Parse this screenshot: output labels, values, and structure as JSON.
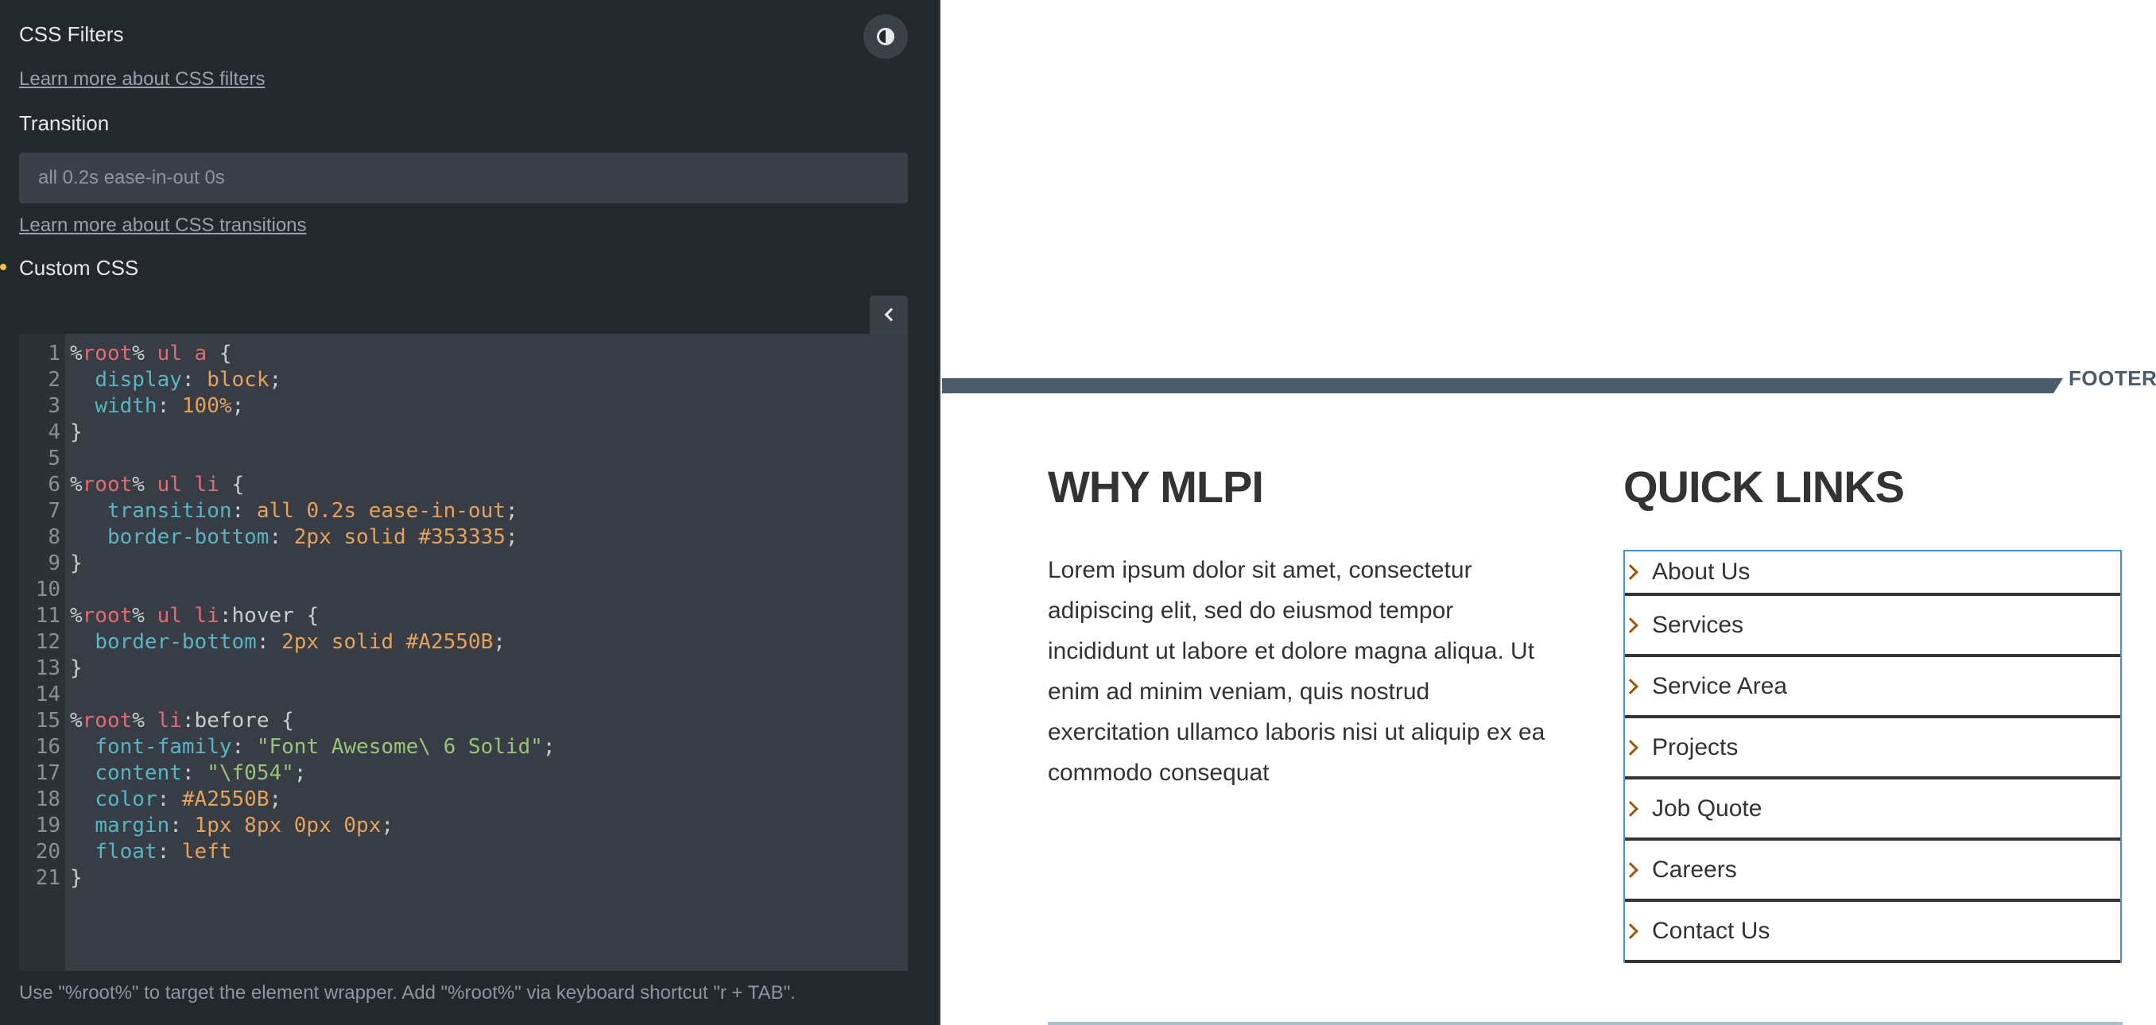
{
  "editor": {
    "title": "CSS Filters",
    "filters_link": "Learn more about CSS filters",
    "transition_label": "Transition",
    "transition_placeholder": "all 0.2s ease-in-out 0s",
    "transitions_link": "Learn more about CSS transitions",
    "custom_css_label": "Custom CSS",
    "contrast_icon": "contrast-icon",
    "collapse_icon": "chevron-left-icon",
    "help_text": "Use \"%root%\" to target the element wrapper. Add \"%root%\" via keyboard shortcut \"r + TAB\".",
    "code_lines": [
      [
        [
          "p",
          "%"
        ],
        [
          "s",
          "root"
        ],
        [
          "p",
          "% "
        ],
        [
          "s",
          "ul a"
        ],
        [
          "p",
          " {"
        ]
      ],
      [
        [
          "p",
          "  "
        ],
        [
          "k",
          "display"
        ],
        [
          "p",
          ": "
        ],
        [
          "v",
          "block"
        ],
        [
          "p",
          ";"
        ]
      ],
      [
        [
          "p",
          "  "
        ],
        [
          "k",
          "width"
        ],
        [
          "p",
          ": "
        ],
        [
          "v",
          "100%"
        ],
        [
          "p",
          ";"
        ]
      ],
      [
        [
          "p",
          "}"
        ]
      ],
      [],
      [
        [
          "p",
          "%"
        ],
        [
          "s",
          "root"
        ],
        [
          "p",
          "% "
        ],
        [
          "s",
          "ul li"
        ],
        [
          "p",
          " {"
        ]
      ],
      [
        [
          "p",
          "   "
        ],
        [
          "k",
          "transition"
        ],
        [
          "p",
          ": "
        ],
        [
          "v",
          "all 0.2s ease-in-out"
        ],
        [
          "p",
          ";"
        ]
      ],
      [
        [
          "p",
          "   "
        ],
        [
          "k",
          "border-bottom"
        ],
        [
          "p",
          ": "
        ],
        [
          "v",
          "2px solid #353335"
        ],
        [
          "p",
          ";"
        ]
      ],
      [
        [
          "p",
          "}"
        ]
      ],
      [],
      [
        [
          "p",
          "%"
        ],
        [
          "s",
          "root"
        ],
        [
          "p",
          "% "
        ],
        [
          "s",
          "ul li"
        ],
        [
          "p",
          ":hover {"
        ]
      ],
      [
        [
          "p",
          "  "
        ],
        [
          "k",
          "border-bottom"
        ],
        [
          "p",
          ": "
        ],
        [
          "v",
          "2px solid #A2550B"
        ],
        [
          "p",
          ";"
        ]
      ],
      [
        [
          "p",
          "}"
        ]
      ],
      [],
      [
        [
          "p",
          "%"
        ],
        [
          "s",
          "root"
        ],
        [
          "p",
          "% "
        ],
        [
          "s",
          "li"
        ],
        [
          "p",
          ":before {"
        ]
      ],
      [
        [
          "p",
          "  "
        ],
        [
          "k",
          "font-family"
        ],
        [
          "p",
          ": "
        ],
        [
          "str",
          "\"Font Awesome\\ 6 Solid\""
        ],
        [
          "p",
          ";"
        ]
      ],
      [
        [
          "p",
          "  "
        ],
        [
          "k",
          "content"
        ],
        [
          "p",
          ": "
        ],
        [
          "str",
          "\"\\f054\""
        ],
        [
          "p",
          ";"
        ]
      ],
      [
        [
          "p",
          "  "
        ],
        [
          "k",
          "color"
        ],
        [
          "p",
          ": "
        ],
        [
          "v",
          "#A2550B"
        ],
        [
          "p",
          ";"
        ]
      ],
      [
        [
          "p",
          "  "
        ],
        [
          "k",
          "margin"
        ],
        [
          "p",
          ": "
        ],
        [
          "v",
          "1px 8px 0px 0px"
        ],
        [
          "p",
          ";"
        ]
      ],
      [
        [
          "p",
          "  "
        ],
        [
          "k",
          "float"
        ],
        [
          "p",
          ": "
        ],
        [
          "v",
          "left"
        ]
      ],
      [
        [
          "p",
          "}"
        ]
      ]
    ]
  },
  "preview": {
    "footer_label": "FOOTER",
    "why_title": "WHY MLPI",
    "why_text": "Lorem ipsum dolor sit amet, consectetur adipiscing elit, sed do eiusmod tempor incididunt ut labore et dolore magna aliqua. Ut enim ad minim veniam, quis nostrud exercitation ullamco laboris nisi ut aliquip ex ea commodo consequat",
    "quick_links_title": "QUICK LINKS",
    "quick_links": [
      "About Us",
      "Services",
      "Service Area",
      "Projects",
      "Job Quote",
      "Careers",
      "Contact Us"
    ],
    "chevron_icon": "chevron-right-icon",
    "accent_color": "#A2550B",
    "bar_color": "#4a5b6b"
  }
}
